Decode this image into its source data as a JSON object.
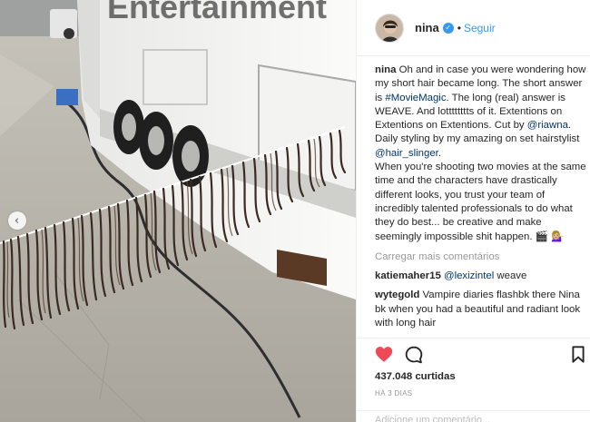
{
  "post": {
    "username": "nina",
    "verified_icon": "verified-badge-icon",
    "separator": "•",
    "follow_label": "Seguir",
    "caption_user": "nina",
    "caption_parts": [
      {
        "text": " Oh and in case you were wondering how my short hair became long. The short answer is ",
        "link": false
      },
      {
        "text": "#MovieMagic",
        "link": true
      },
      {
        "text": ". The long (real) answer is WEAVE. And lotttttttts of it. Extentions on Extentions on Extentions. Cut by ",
        "link": false
      },
      {
        "text": "@riawna",
        "link": true
      },
      {
        "text": ". Daily styling by my amazing on set hairstylist ",
        "link": false
      },
      {
        "text": "@hair_slinger",
        "link": true
      },
      {
        "text": ".\nWhen you're shooting two movies at the same time and the characters have drastically different looks, you trust your team of incredibly talented professionals to do what they do best... be creative and make seemingly impossible shit happen. 🎬 💁🏼‍♀️",
        "link": false
      }
    ],
    "load_more_label": "Carregar mais comentários",
    "comments": [
      {
        "user": "katiemaher15",
        "parts": [
          {
            "text": " ",
            "link": false
          },
          {
            "text": "@lexizintel",
            "link": true
          },
          {
            "text": " weave",
            "link": false
          }
        ]
      },
      {
        "user": "wytegold",
        "parts": [
          {
            "text": " Vampire diaries flashbk there Nina bk when you had a beautiful and radiant look with long hair",
            "link": false
          }
        ]
      }
    ],
    "likes_text": "437.048 curtidas",
    "time_text": "HÁ 3 DIAS",
    "add_comment_placeholder": "Adicione um comentário...",
    "icons": {
      "like": "heart-icon",
      "comment": "comment-icon",
      "save": "bookmark-icon",
      "prev": "chevron-left-icon"
    },
    "colors": {
      "like": "#ed4956",
      "link": "#003569",
      "follow": "#3897f0",
      "muted": "#999999"
    }
  }
}
